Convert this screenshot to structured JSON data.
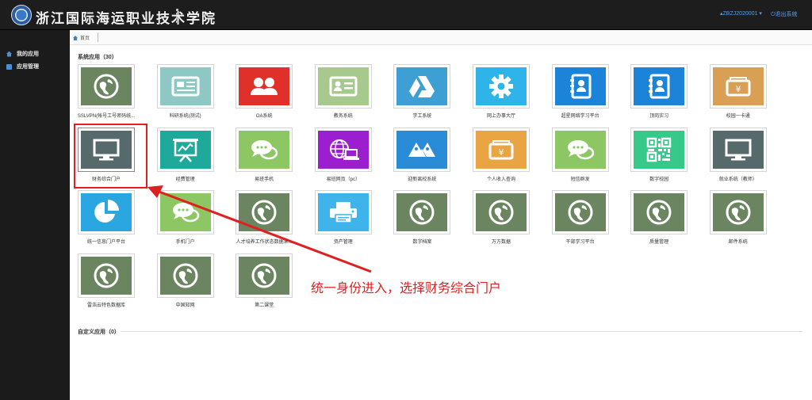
{
  "header": {
    "school_name": "浙江国际海运职业技术学院",
    "user": "▴ZBZJ2020001 ▾",
    "logout": "⏻退出系统"
  },
  "sidebar": {
    "items": [
      {
        "label": "我的应用",
        "icon": "home-icon"
      },
      {
        "label": "应用管理",
        "icon": "app-manage-icon"
      }
    ]
  },
  "breadcrumb": {
    "home_label": "首页"
  },
  "sections": {
    "system_apps_title": "系统应用（30）",
    "custom_apps_title": "自定义应用（0）"
  },
  "apps": [
    {
      "label": "SSLVPN(帐号工号密码统...",
      "color": "#6b8560",
      "icon": "globe-icon"
    },
    {
      "label": "科研系统(测试)",
      "color": "#8ec8c4",
      "icon": "newspaper-icon"
    },
    {
      "label": "OA系统",
      "color": "#e0302a",
      "icon": "users-icon"
    },
    {
      "label": "教务系统",
      "color": "#a8c98e",
      "icon": "id-card-icon"
    },
    {
      "label": "学工系统",
      "color": "#3d9fd3",
      "icon": "drive-icon"
    },
    {
      "label": "网上办事大厅",
      "color": "#2eb4e8",
      "icon": "gear-icon"
    },
    {
      "label": "超星网络学习平台",
      "color": "#1b84d8",
      "icon": "contacts-icon"
    },
    {
      "label": "顶岗实习",
      "color": "#1b84d8",
      "icon": "contacts-icon"
    },
    {
      "label": "校园一卡通",
      "color": "#d9a055",
      "icon": "wallet-icon"
    },
    {
      "label": "财务综合门户",
      "color": "#56696b",
      "icon": "monitor-icon"
    },
    {
      "label": "经费管理",
      "color": "#1fa99b",
      "icon": "presentation-icon"
    },
    {
      "label": "易班手机",
      "color": "#8cc764",
      "icon": "chat-icon"
    },
    {
      "label": "易班网页（pc）",
      "color": "#9b1fcf",
      "icon": "web-icon"
    },
    {
      "label": "迎新离校系统",
      "color": "#2a8bd6",
      "icon": "group-icon"
    },
    {
      "label": "个人收入查询",
      "color": "#e9a443",
      "icon": "wallet-icon"
    },
    {
      "label": "短信群发",
      "color": "#8cc764",
      "icon": "chat-icon"
    },
    {
      "label": "数字校园",
      "color": "#37c98a",
      "icon": "qrcode-icon"
    },
    {
      "label": "就业系统（教师）",
      "color": "#56696b",
      "icon": "monitor-icon"
    },
    {
      "label": "统一信息门户平台",
      "color": "#2aa6e0",
      "icon": "pie-chart-icon"
    },
    {
      "label": "手机门户",
      "color": "#8cc764",
      "icon": "chat-icon"
    },
    {
      "label": "人才培养工作状态数据采...",
      "color": "#6b8560",
      "icon": "globe-icon"
    },
    {
      "label": "资产管理",
      "color": "#3fb4ea",
      "icon": "printer-icon"
    },
    {
      "label": "数字档案",
      "color": "#6b8560",
      "icon": "globe-icon"
    },
    {
      "label": "万方数据",
      "color": "#6b8560",
      "icon": "globe-icon"
    },
    {
      "label": "干部学习平台",
      "color": "#6b8560",
      "icon": "globe-icon"
    },
    {
      "label": "质量管理",
      "color": "#6b8560",
      "icon": "globe-icon"
    },
    {
      "label": "邮件系统",
      "color": "#6b8560",
      "icon": "globe-icon"
    },
    {
      "label": "雷浩云特色数据库",
      "color": "#6b8560",
      "icon": "globe-icon"
    },
    {
      "label": "中国知网",
      "color": "#6b8560",
      "icon": "globe-icon"
    },
    {
      "label": "第二课堂",
      "color": "#6b8560",
      "icon": "globe-icon"
    }
  ],
  "annotation": {
    "text": "统一身份进入，选择财务综合门户",
    "color": "#e02020"
  }
}
